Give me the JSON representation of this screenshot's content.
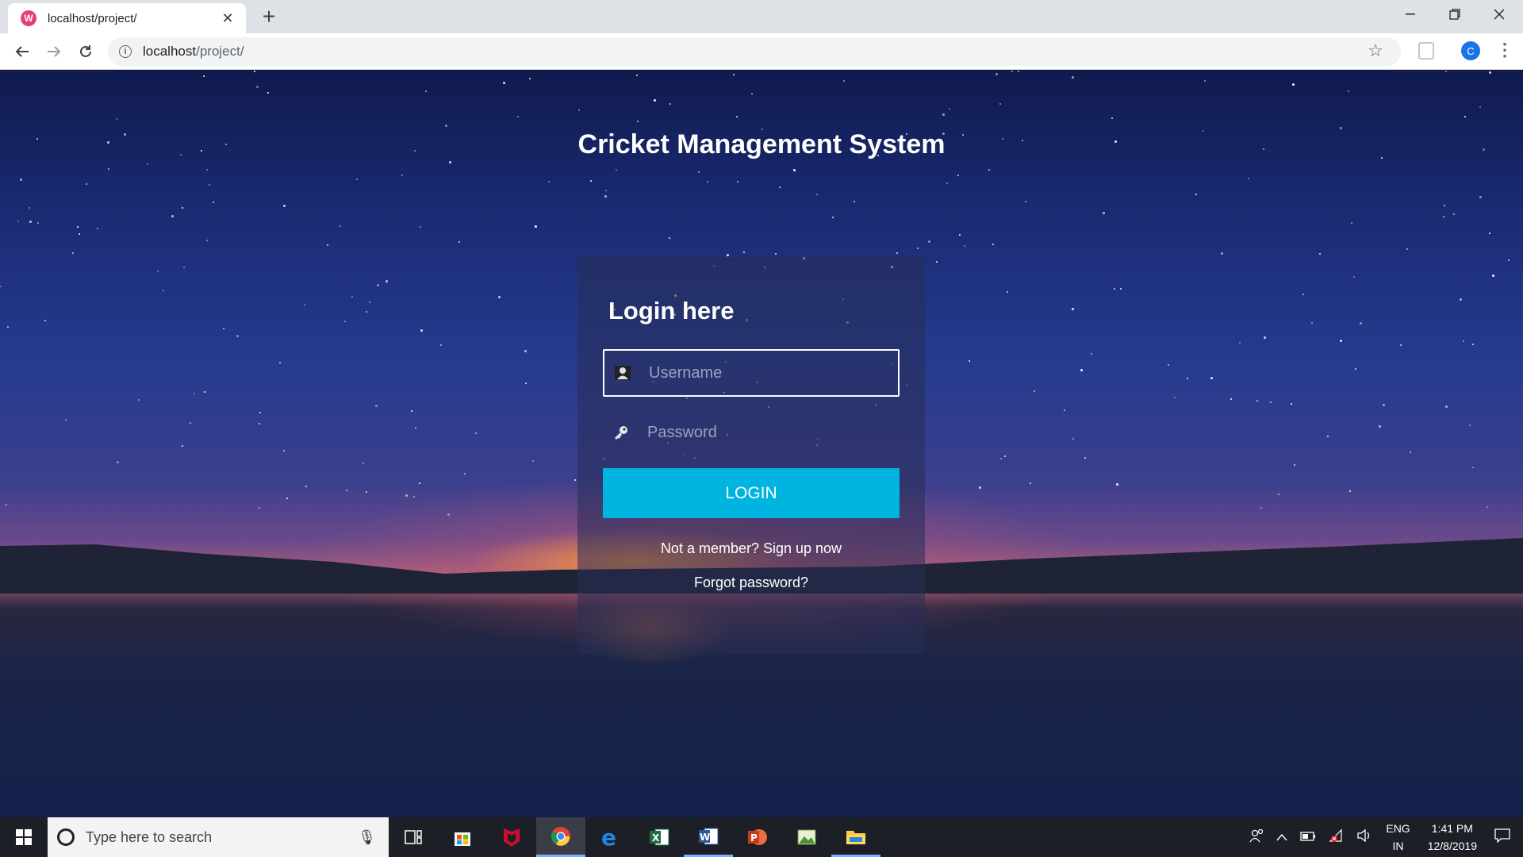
{
  "browser": {
    "tab_title": "localhost/project/",
    "tab_favicon": "W",
    "url_host": "localhost",
    "url_path": "/project/",
    "profile_initial": "C"
  },
  "page": {
    "title": "Cricket Management System",
    "login_heading": "Login here",
    "username_placeholder": "Username",
    "password_placeholder": "Password",
    "login_button": "LOGIN",
    "signup_link": "Not a member? Sign up now",
    "forgot_link": "Forgot password?",
    "accent_color": "#00b4e0"
  },
  "taskbar": {
    "search_placeholder": "Type here to search",
    "apps": [
      "task-view",
      "store",
      "mcafee",
      "chrome",
      "edge",
      "excel",
      "word",
      "powerpoint",
      "photos",
      "file-explorer"
    ],
    "lang_line1": "ENG",
    "lang_line2": "IN",
    "time": "1:41 PM",
    "date": "12/8/2019"
  }
}
